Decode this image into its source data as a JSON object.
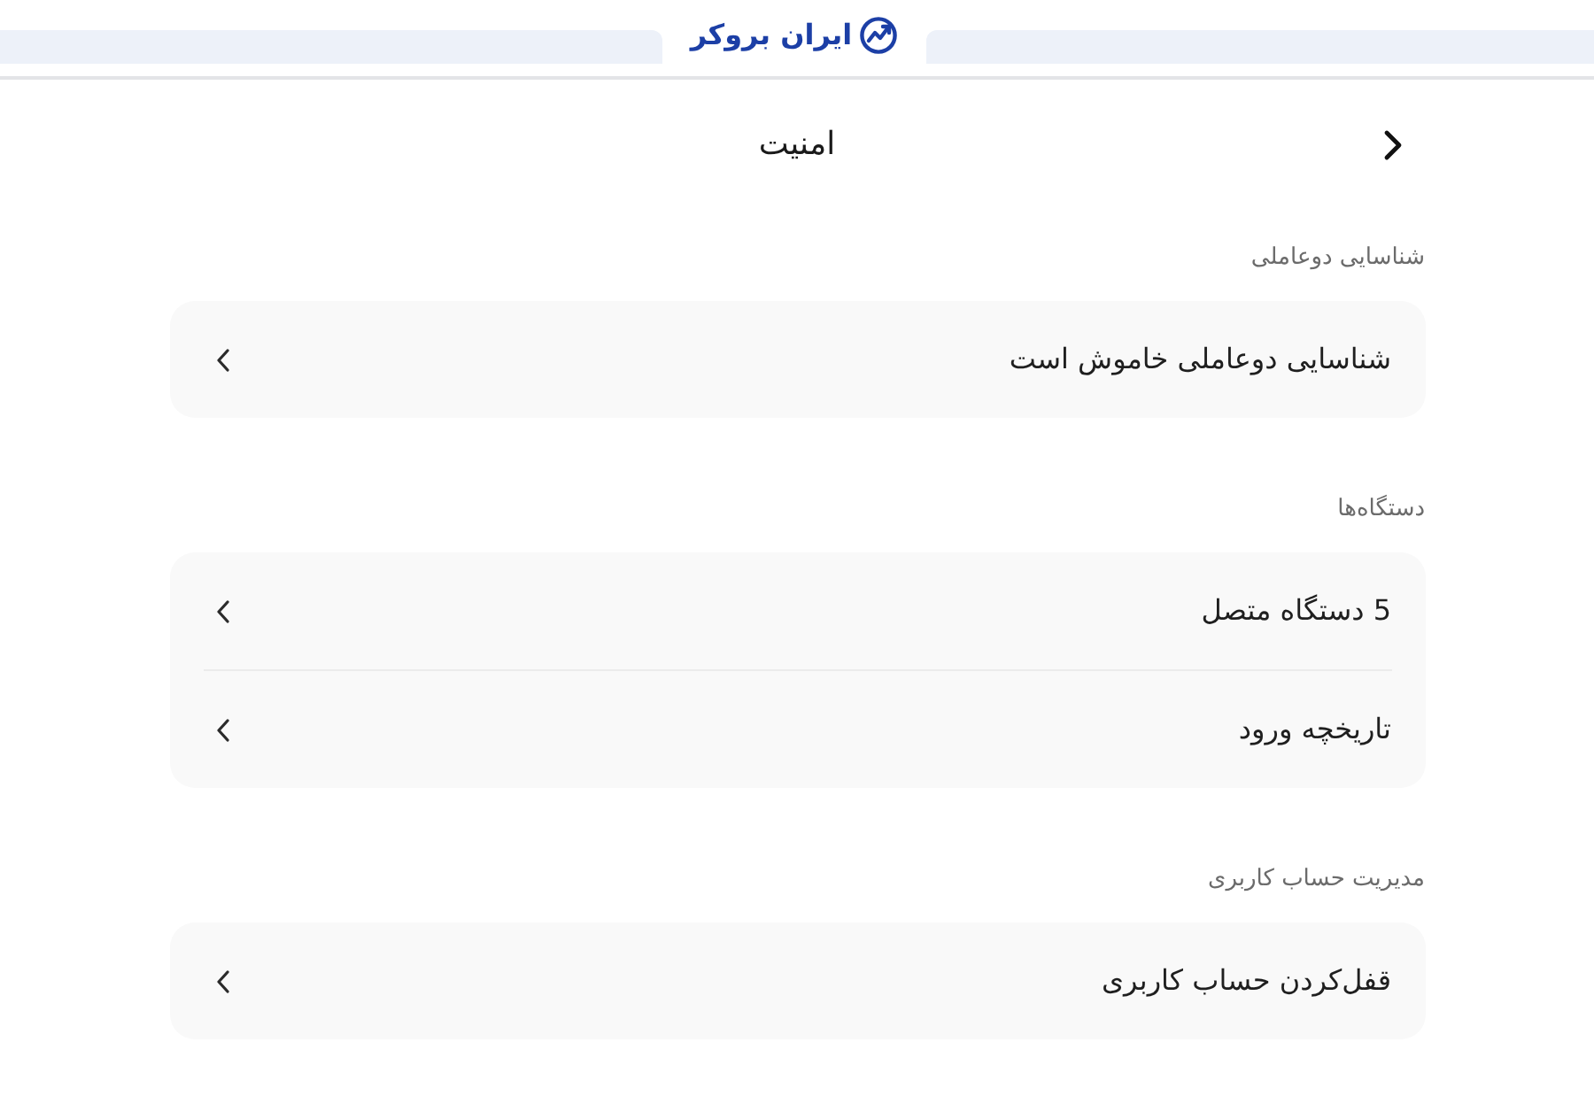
{
  "header": {
    "logo_text": "ایران بروکر"
  },
  "page": {
    "title": "امنیت"
  },
  "sections": [
    {
      "heading": "شناسایی دوعاملی",
      "items": [
        {
          "label": "شناسایی دوعاملی خاموش است"
        }
      ]
    },
    {
      "heading": "دستگاه‌ها",
      "items": [
        {
          "label": "5 دستگاه متصل"
        },
        {
          "label": "تاریخچه ورود"
        }
      ]
    },
    {
      "heading": "مدیریت حساب کاربری",
      "items": [
        {
          "label": "قفل‌کردن حساب کاربری"
        }
      ]
    }
  ]
}
